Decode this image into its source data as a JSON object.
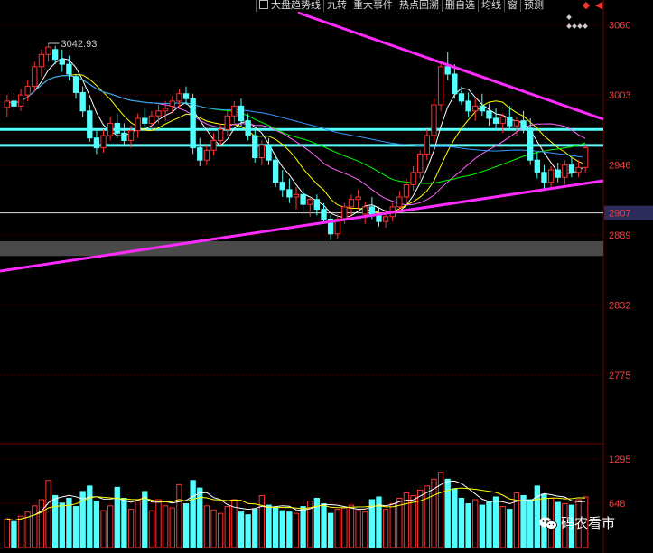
{
  "toolbar": {
    "checkbox_label": "大盘趋势线",
    "items": [
      "九转",
      "重大事件",
      "热点回溯",
      "删自选",
      "均线",
      "窗",
      "预测"
    ]
  },
  "watermark": {
    "text": "码农看市",
    "icon": "wechat-icon"
  },
  "colors": {
    "up": "#ff3232",
    "down": "#54ffff",
    "price_label": "#ff3b3b",
    "grid": "#5a0000",
    "trend": "#ff2bff",
    "cyan_line": "#54ffff",
    "current_price_bg": "#2c2c5c",
    "ma5": "#ffffff",
    "ma10": "#ffff00",
    "ma20": "#ff66ff",
    "ma30": "#00ff00",
    "ma60": "#3399ff"
  },
  "chart_data": {
    "type": "candlestick",
    "price_ticks": [
      "3060",
      "3003",
      "2946",
      "2907",
      "2889",
      "2832",
      "2775"
    ],
    "volume_ticks": [
      "1295",
      "648"
    ],
    "max_label": "3042.93",
    "current_price_label": "2907",
    "ylim": [
      2720,
      3070
    ],
    "candles": [
      [
        2993,
        3003,
        2985,
        2998
      ],
      [
        2998,
        3005,
        2990,
        2994
      ],
      [
        2994,
        3008,
        2990,
        3003
      ],
      [
        3003,
        3015,
        2998,
        3010
      ],
      [
        3010,
        3030,
        3006,
        3026
      ],
      [
        3026,
        3040,
        3018,
        3036
      ],
      [
        3036,
        3045,
        3030,
        3042
      ],
      [
        3040,
        3043,
        3028,
        3032
      ],
      [
        3032,
        3040,
        3022,
        3028
      ],
      [
        3028,
        3035,
        3015,
        3020
      ],
      [
        3018,
        3020,
        3000,
        3005
      ],
      [
        3005,
        3010,
        2985,
        2990
      ],
      [
        2990,
        2995,
        2965,
        2968
      ],
      [
        2968,
        2975,
        2955,
        2960
      ],
      [
        2960,
        2975,
        2956,
        2970
      ],
      [
        2970,
        2985,
        2966,
        2980
      ],
      [
        2980,
        2988,
        2968,
        2972
      ],
      [
        2972,
        2980,
        2962,
        2966
      ],
      [
        2966,
        2978,
        2960,
        2974
      ],
      [
        2974,
        2988,
        2968,
        2984
      ],
      [
        2984,
        2992,
        2976,
        2980
      ],
      [
        2980,
        2990,
        2974,
        2986
      ],
      [
        2986,
        2995,
        2980,
        2990
      ],
      [
        2990,
        2998,
        2982,
        2992
      ],
      [
        2994,
        3002,
        2988,
        2998
      ],
      [
        2998,
        3008,
        2992,
        3004
      ],
      [
        3004,
        3010,
        2995,
        3000
      ],
      [
        3000,
        3004,
        2955,
        2960
      ],
      [
        2960,
        2968,
        2945,
        2950
      ],
      [
        2950,
        2962,
        2946,
        2958
      ],
      [
        2958,
        2972,
        2954,
        2966
      ],
      [
        2966,
        2980,
        2962,
        2975
      ],
      [
        2975,
        2990,
        2970,
        2986
      ],
      [
        2986,
        2998,
        2980,
        2994
      ],
      [
        2994,
        3000,
        2978,
        2982
      ],
      [
        2982,
        2988,
        2966,
        2970
      ],
      [
        2970,
        2976,
        2948,
        2952
      ],
      [
        2952,
        2966,
        2946,
        2962
      ],
      [
        2962,
        2968,
        2946,
        2950
      ],
      [
        2950,
        2955,
        2928,
        2932
      ],
      [
        2932,
        2942,
        2920,
        2926
      ],
      [
        2926,
        2935,
        2915,
        2920
      ],
      [
        2920,
        2928,
        2910,
        2922
      ],
      [
        2922,
        2928,
        2908,
        2914
      ],
      [
        2914,
        2920,
        2904,
        2918
      ],
      [
        2918,
        2922,
        2905,
        2910
      ],
      [
        2910,
        2915,
        2898,
        2902
      ],
      [
        2902,
        2905,
        2885,
        2890
      ],
      [
        2890,
        2906,
        2886,
        2902
      ],
      [
        2902,
        2915,
        2898,
        2912
      ],
      [
        2912,
        2922,
        2905,
        2918
      ],
      [
        2918,
        2926,
        2910,
        2920
      ],
      [
        2906,
        2916,
        2898,
        2912
      ],
      [
        2912,
        2920,
        2902,
        2906
      ],
      [
        2906,
        2912,
        2896,
        2900
      ],
      [
        2900,
        2910,
        2895,
        2904
      ],
      [
        2904,
        2915,
        2900,
        2912
      ],
      [
        2912,
        2925,
        2908,
        2920
      ],
      [
        2920,
        2935,
        2915,
        2930
      ],
      [
        2930,
        2945,
        2925,
        2940
      ],
      [
        2940,
        2958,
        2935,
        2955
      ],
      [
        2955,
        2975,
        2950,
        2970
      ],
      [
        2970,
        3000,
        2965,
        2995
      ],
      [
        2995,
        3030,
        2990,
        3026
      ],
      [
        3026,
        3038,
        3015,
        3020
      ],
      [
        3020,
        3028,
        3000,
        3004
      ],
      [
        3004,
        3010,
        2995,
        2998
      ],
      [
        2998,
        3005,
        2985,
        2990
      ],
      [
        2990,
        3000,
        2982,
        2994
      ],
      [
        2994,
        3004,
        2986,
        2990
      ],
      [
        2990,
        2996,
        2978,
        2984
      ],
      [
        2984,
        2992,
        2975,
        2980
      ],
      [
        2980,
        2988,
        2972,
        2985
      ],
      [
        2985,
        2994,
        2974,
        2978
      ],
      [
        2978,
        2985,
        2970,
        2982
      ],
      [
        2982,
        2990,
        2972,
        2976
      ],
      [
        2976,
        2984,
        2946,
        2950
      ],
      [
        2950,
        2956,
        2935,
        2940
      ],
      [
        2940,
        2946,
        2925,
        2932
      ],
      [
        2932,
        2945,
        2928,
        2942
      ],
      [
        2942,
        2948,
        2932,
        2936
      ],
      [
        2936,
        2950,
        2930,
        2946
      ],
      [
        2946,
        2952,
        2936,
        2940
      ],
      [
        2940,
        2950,
        2936,
        2944
      ],
      [
        2944,
        2962,
        2940,
        2960
      ]
    ],
    "volumes": [
      420,
      380,
      460,
      520,
      610,
      700,
      980,
      760,
      650,
      720,
      600,
      820,
      900,
      680,
      540,
      610,
      880,
      720,
      560,
      690,
      820,
      540,
      700,
      610,
      580,
      920,
      640,
      980,
      870,
      610,
      550,
      500,
      600,
      700,
      520,
      480,
      560,
      760,
      620,
      580,
      540,
      520,
      500,
      600,
      680,
      720,
      640,
      500,
      560,
      580,
      620,
      540,
      520,
      700,
      740,
      560,
      640,
      720,
      800,
      760,
      840,
      900,
      1000,
      1100,
      1000,
      860,
      720,
      640,
      700,
      620,
      680,
      740,
      600,
      560,
      800,
      760,
      700,
      900,
      780,
      720,
      660,
      640,
      620,
      700,
      740
    ]
  }
}
